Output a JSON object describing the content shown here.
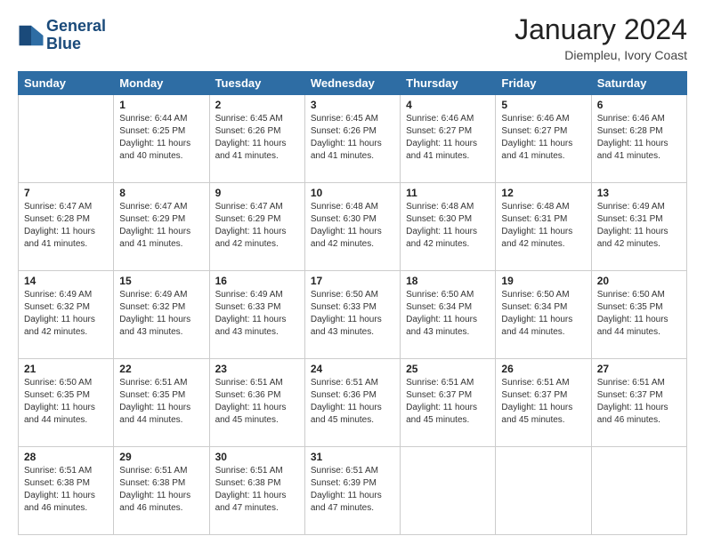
{
  "header": {
    "logo_line1": "General",
    "logo_line2": "Blue",
    "month": "January 2024",
    "location": "Diempleu, Ivory Coast"
  },
  "weekdays": [
    "Sunday",
    "Monday",
    "Tuesday",
    "Wednesday",
    "Thursday",
    "Friday",
    "Saturday"
  ],
  "weeks": [
    [
      {
        "day": "",
        "sunrise": "",
        "sunset": "",
        "daylight": ""
      },
      {
        "day": "1",
        "sunrise": "Sunrise: 6:44 AM",
        "sunset": "Sunset: 6:25 PM",
        "daylight": "Daylight: 11 hours and 40 minutes."
      },
      {
        "day": "2",
        "sunrise": "Sunrise: 6:45 AM",
        "sunset": "Sunset: 6:26 PM",
        "daylight": "Daylight: 11 hours and 41 minutes."
      },
      {
        "day": "3",
        "sunrise": "Sunrise: 6:45 AM",
        "sunset": "Sunset: 6:26 PM",
        "daylight": "Daylight: 11 hours and 41 minutes."
      },
      {
        "day": "4",
        "sunrise": "Sunrise: 6:46 AM",
        "sunset": "Sunset: 6:27 PM",
        "daylight": "Daylight: 11 hours and 41 minutes."
      },
      {
        "day": "5",
        "sunrise": "Sunrise: 6:46 AM",
        "sunset": "Sunset: 6:27 PM",
        "daylight": "Daylight: 11 hours and 41 minutes."
      },
      {
        "day": "6",
        "sunrise": "Sunrise: 6:46 AM",
        "sunset": "Sunset: 6:28 PM",
        "daylight": "Daylight: 11 hours and 41 minutes."
      }
    ],
    [
      {
        "day": "7",
        "sunrise": "Sunrise: 6:47 AM",
        "sunset": "Sunset: 6:28 PM",
        "daylight": "Daylight: 11 hours and 41 minutes."
      },
      {
        "day": "8",
        "sunrise": "Sunrise: 6:47 AM",
        "sunset": "Sunset: 6:29 PM",
        "daylight": "Daylight: 11 hours and 41 minutes."
      },
      {
        "day": "9",
        "sunrise": "Sunrise: 6:47 AM",
        "sunset": "Sunset: 6:29 PM",
        "daylight": "Daylight: 11 hours and 42 minutes."
      },
      {
        "day": "10",
        "sunrise": "Sunrise: 6:48 AM",
        "sunset": "Sunset: 6:30 PM",
        "daylight": "Daylight: 11 hours and 42 minutes."
      },
      {
        "day": "11",
        "sunrise": "Sunrise: 6:48 AM",
        "sunset": "Sunset: 6:30 PM",
        "daylight": "Daylight: 11 hours and 42 minutes."
      },
      {
        "day": "12",
        "sunrise": "Sunrise: 6:48 AM",
        "sunset": "Sunset: 6:31 PM",
        "daylight": "Daylight: 11 hours and 42 minutes."
      },
      {
        "day": "13",
        "sunrise": "Sunrise: 6:49 AM",
        "sunset": "Sunset: 6:31 PM",
        "daylight": "Daylight: 11 hours and 42 minutes."
      }
    ],
    [
      {
        "day": "14",
        "sunrise": "Sunrise: 6:49 AM",
        "sunset": "Sunset: 6:32 PM",
        "daylight": "Daylight: 11 hours and 42 minutes."
      },
      {
        "day": "15",
        "sunrise": "Sunrise: 6:49 AM",
        "sunset": "Sunset: 6:32 PM",
        "daylight": "Daylight: 11 hours and 43 minutes."
      },
      {
        "day": "16",
        "sunrise": "Sunrise: 6:49 AM",
        "sunset": "Sunset: 6:33 PM",
        "daylight": "Daylight: 11 hours and 43 minutes."
      },
      {
        "day": "17",
        "sunrise": "Sunrise: 6:50 AM",
        "sunset": "Sunset: 6:33 PM",
        "daylight": "Daylight: 11 hours and 43 minutes."
      },
      {
        "day": "18",
        "sunrise": "Sunrise: 6:50 AM",
        "sunset": "Sunset: 6:34 PM",
        "daylight": "Daylight: 11 hours and 43 minutes."
      },
      {
        "day": "19",
        "sunrise": "Sunrise: 6:50 AM",
        "sunset": "Sunset: 6:34 PM",
        "daylight": "Daylight: 11 hours and 44 minutes."
      },
      {
        "day": "20",
        "sunrise": "Sunrise: 6:50 AM",
        "sunset": "Sunset: 6:35 PM",
        "daylight": "Daylight: 11 hours and 44 minutes."
      }
    ],
    [
      {
        "day": "21",
        "sunrise": "Sunrise: 6:50 AM",
        "sunset": "Sunset: 6:35 PM",
        "daylight": "Daylight: 11 hours and 44 minutes."
      },
      {
        "day": "22",
        "sunrise": "Sunrise: 6:51 AM",
        "sunset": "Sunset: 6:35 PM",
        "daylight": "Daylight: 11 hours and 44 minutes."
      },
      {
        "day": "23",
        "sunrise": "Sunrise: 6:51 AM",
        "sunset": "Sunset: 6:36 PM",
        "daylight": "Daylight: 11 hours and 45 minutes."
      },
      {
        "day": "24",
        "sunrise": "Sunrise: 6:51 AM",
        "sunset": "Sunset: 6:36 PM",
        "daylight": "Daylight: 11 hours and 45 minutes."
      },
      {
        "day": "25",
        "sunrise": "Sunrise: 6:51 AM",
        "sunset": "Sunset: 6:37 PM",
        "daylight": "Daylight: 11 hours and 45 minutes."
      },
      {
        "day": "26",
        "sunrise": "Sunrise: 6:51 AM",
        "sunset": "Sunset: 6:37 PM",
        "daylight": "Daylight: 11 hours and 45 minutes."
      },
      {
        "day": "27",
        "sunrise": "Sunrise: 6:51 AM",
        "sunset": "Sunset: 6:37 PM",
        "daylight": "Daylight: 11 hours and 46 minutes."
      }
    ],
    [
      {
        "day": "28",
        "sunrise": "Sunrise: 6:51 AM",
        "sunset": "Sunset: 6:38 PM",
        "daylight": "Daylight: 11 hours and 46 minutes."
      },
      {
        "day": "29",
        "sunrise": "Sunrise: 6:51 AM",
        "sunset": "Sunset: 6:38 PM",
        "daylight": "Daylight: 11 hours and 46 minutes."
      },
      {
        "day": "30",
        "sunrise": "Sunrise: 6:51 AM",
        "sunset": "Sunset: 6:38 PM",
        "daylight": "Daylight: 11 hours and 47 minutes."
      },
      {
        "day": "31",
        "sunrise": "Sunrise: 6:51 AM",
        "sunset": "Sunset: 6:39 PM",
        "daylight": "Daylight: 11 hours and 47 minutes."
      },
      {
        "day": "",
        "sunrise": "",
        "sunset": "",
        "daylight": ""
      },
      {
        "day": "",
        "sunrise": "",
        "sunset": "",
        "daylight": ""
      },
      {
        "day": "",
        "sunrise": "",
        "sunset": "",
        "daylight": ""
      }
    ]
  ]
}
